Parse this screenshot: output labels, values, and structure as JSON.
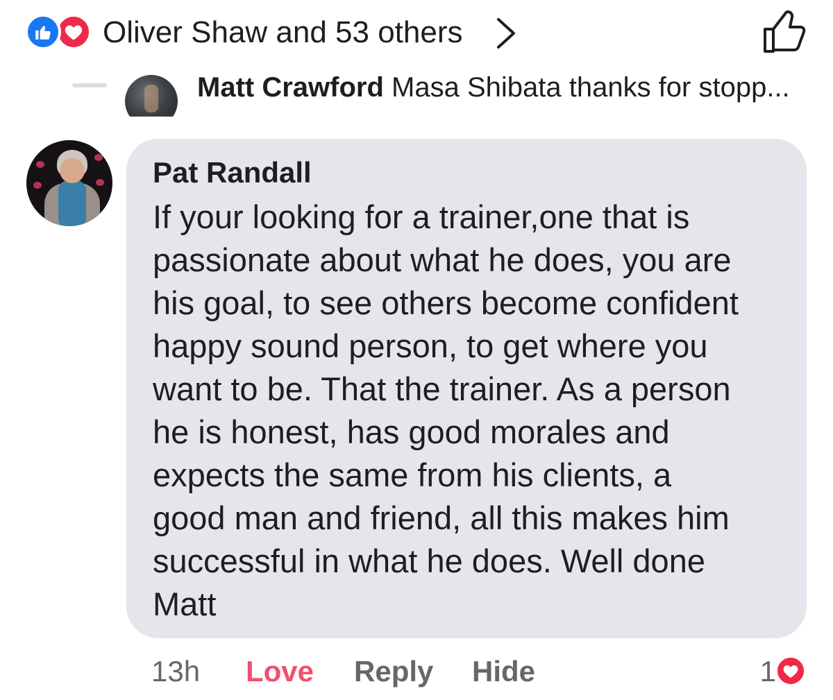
{
  "reactions": {
    "summary": "Oliver Shaw and 53 others",
    "icons": [
      "like-icon",
      "love-icon"
    ],
    "colors": {
      "like": "#1877f2",
      "love": "#f02849"
    }
  },
  "previous_reply": {
    "author": "Matt Crawford",
    "snippet": "Masa Shibata thanks for stopp..."
  },
  "comment": {
    "author": "Pat Randall",
    "lines": [
      "If your looking for a trainer,one that is",
      "passionate about what he does, you are",
      "his goal, to see others become confident",
      "happy sound person, to get where you",
      "want to be. That the trainer. As a person",
      "he is honest, has good morales and",
      "expects the same from his clients, a",
      "good man and friend, all this makes him",
      "successful in what he does. Well done",
      "Matt"
    ],
    "time": "13h",
    "actions": {
      "love": "Love",
      "reply": "Reply",
      "hide": "Hide"
    },
    "reaction_count": "1",
    "reaction_icon": "love-icon",
    "colors": {
      "bubble": "#e4e6eb",
      "love_text": "#f0506e"
    }
  }
}
